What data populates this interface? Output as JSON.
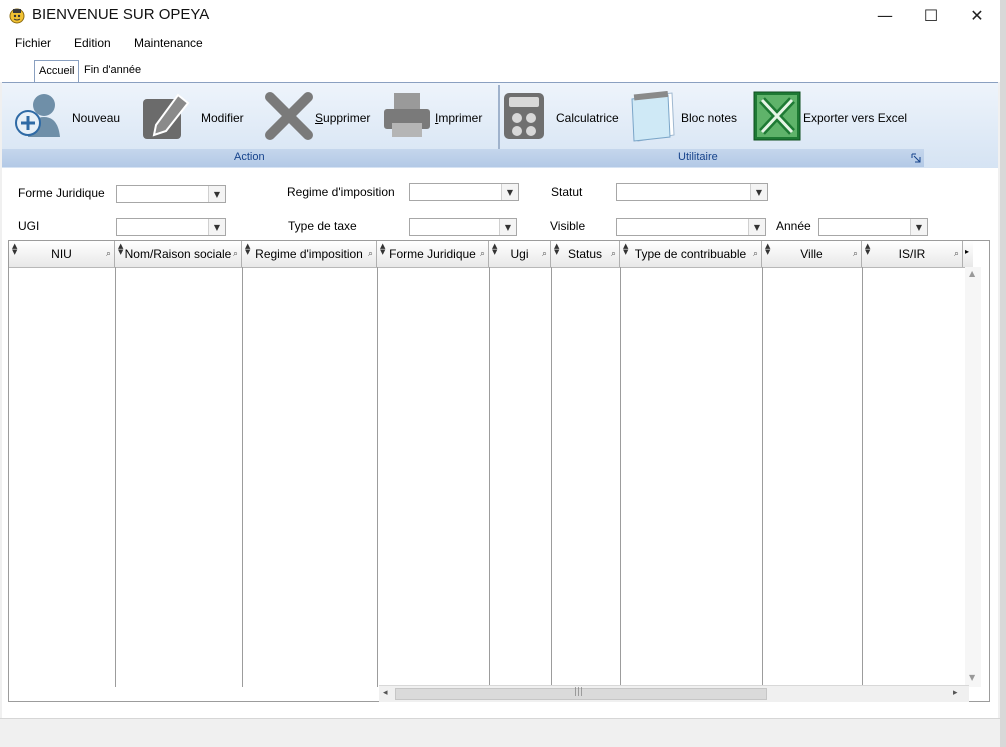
{
  "window": {
    "title": "BIENVENUE SUR OPEYA",
    "minimize_glyph": "—",
    "maximize_glyph": "☐",
    "close_glyph": "✕"
  },
  "menu": [
    "Fichier",
    "Edition",
    "Maintenance"
  ],
  "tabs": [
    "Accueil",
    "Fin d'année"
  ],
  "ribbon": {
    "action_group": "Action",
    "utility_group": "Utilitaire",
    "buttons": {
      "nouveau": "Nouveau",
      "modifier": "Modifier",
      "supprimer_first": "S",
      "supprimer_rest": "upprimer",
      "imprimer_first": "I",
      "imprimer_rest": "mprimer",
      "calculatrice": "Calculatrice",
      "bloc_notes": "Bloc notes",
      "exporter": "Exporter vers Excel"
    },
    "icons": [
      "add-user-icon",
      "edit-icon",
      "delete-icon",
      "printer-icon",
      "calculator-icon",
      "notepad-icon",
      "excel-icon"
    ]
  },
  "filters": {
    "forme_juridique": "Forme Juridique",
    "regime": "Regime d'imposition",
    "statut": "Statut",
    "ugi": "UGI",
    "type_taxe": "Type de taxe",
    "visible": "Visible",
    "annee": "Année"
  },
  "grid": {
    "columns": [
      "NIU",
      "Nom/Raison sociale",
      "Regime d'imposition",
      "Forme Juridique",
      "Ugi",
      "Status",
      "Type de contribuable",
      "Ville",
      "IS/IR"
    ],
    "scroll_glyph": "|||"
  },
  "colors": {
    "accent": "#15428b",
    "ribbon": "#d5e3f3",
    "excel_green": "#1e7a34"
  }
}
